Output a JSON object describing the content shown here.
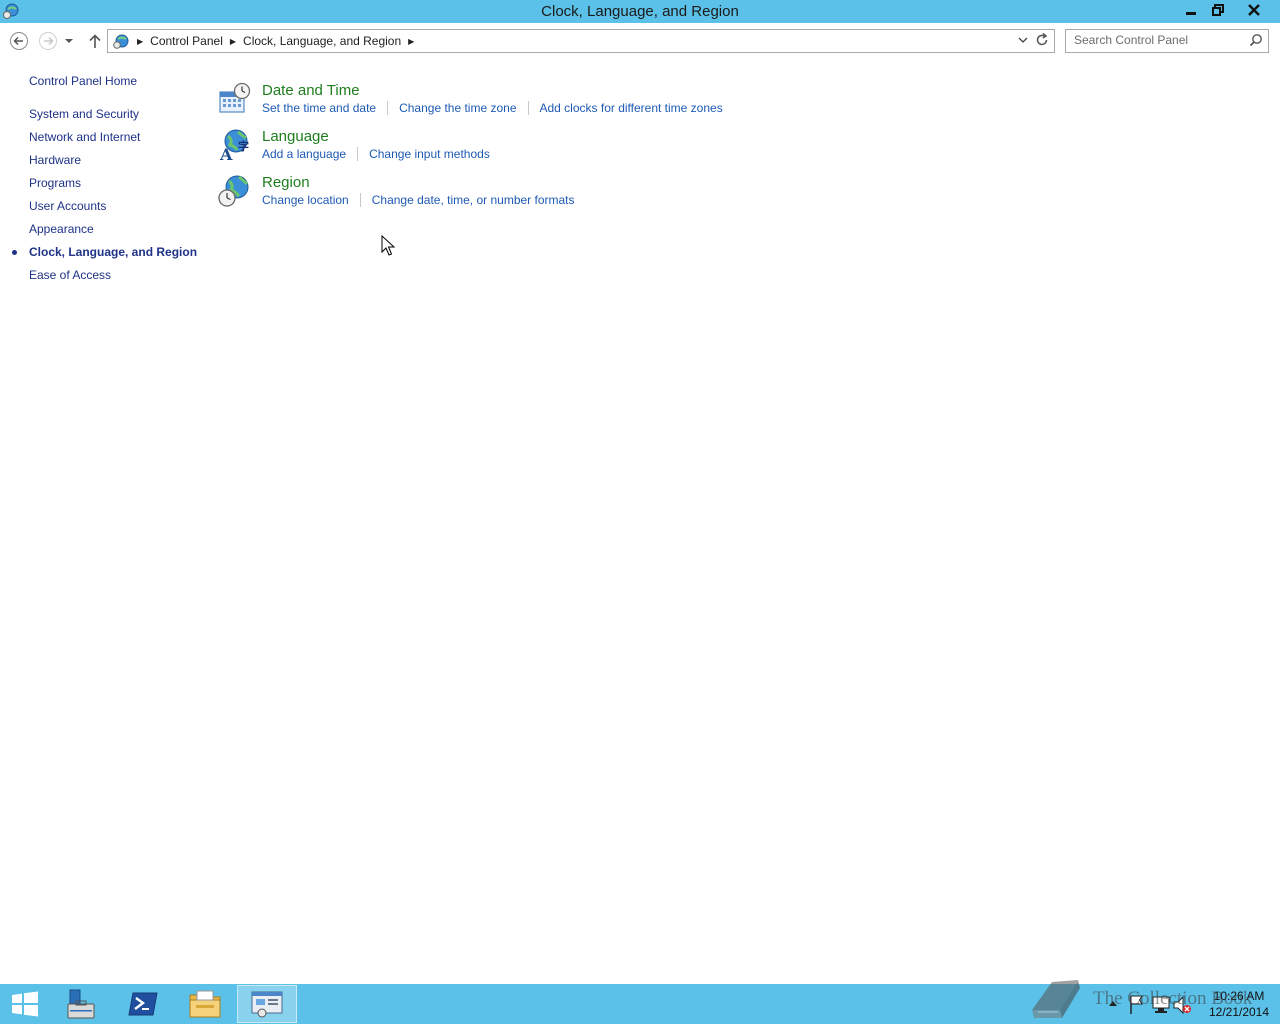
{
  "window": {
    "title": "Clock, Language, and Region",
    "buttons": {
      "minimize": "minimize",
      "maximize": "restore",
      "close": "close"
    }
  },
  "navbar": {
    "breadcrumbs": [
      "Control Panel",
      "Clock, Language, and Region"
    ],
    "search_placeholder": "Search Control Panel"
  },
  "sidebar": {
    "home": "Control Panel Home",
    "items": [
      "System and Security",
      "Network and Internet",
      "Hardware",
      "Programs",
      "User Accounts",
      "Appearance",
      "Clock, Language, and Region",
      "Ease of Access"
    ],
    "current_index": 6
  },
  "categories": [
    {
      "title": "Date and Time",
      "icon": "date-time-icon",
      "links": [
        "Set the time and date",
        "Change the time zone",
        "Add clocks for different time zones"
      ]
    },
    {
      "title": "Language",
      "icon": "language-icon",
      "links": [
        "Add a language",
        "Change input methods"
      ]
    },
    {
      "title": "Region",
      "icon": "region-icon",
      "links": [
        "Change location",
        "Change date, time, or number formats"
      ]
    }
  ],
  "taskbar": {
    "clock_time": "10:26 AM",
    "clock_date": "12/21/2014",
    "watermark": "The Collection Book"
  },
  "colors": {
    "chrome": "#5bc1e8",
    "link": "#1e5ab4",
    "category_title": "#1e7d1e",
    "nav_text": "#1e3287"
  }
}
